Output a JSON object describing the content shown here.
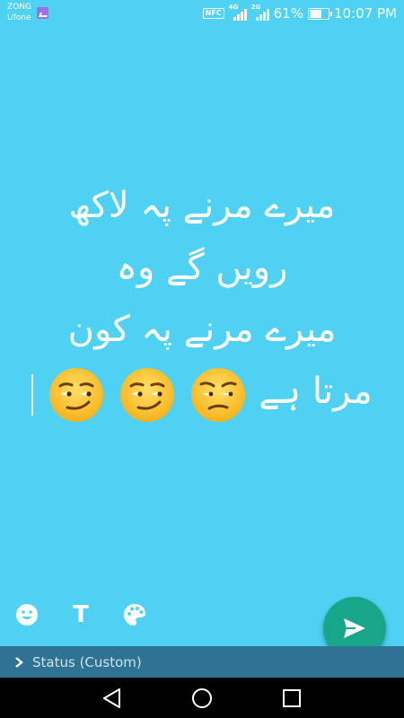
{
  "status_bar": {
    "carrier_1": "ZONG",
    "carrier_2": "Ufone",
    "nfc_label": "NFC",
    "network_1": "4G",
    "network_2": "2G",
    "battery_percent": "61%",
    "battery_level": 0.61,
    "time": "10:07 PM"
  },
  "editor": {
    "lines": [
      "میرے مرنے پہ لاکھ",
      "رویں گے وہ",
      "میرے مرنے پہ کون",
      "مرتا ہے"
    ],
    "emojis": [
      "smirking-face",
      "smirking-face",
      "unamused-face"
    ]
  },
  "toolbar": {
    "emoji_icon": "smiley-icon",
    "text_tool_label": "T",
    "palette_icon": "palette-icon",
    "send_icon": "send-icon"
  },
  "bottom_bar": {
    "chevron_icon": "chevron-right-icon",
    "status_label": "Status (Custom)"
  },
  "nav_bar": {
    "back_icon": "back-triangle-icon",
    "home_icon": "home-circle-icon",
    "recent_icon": "recent-square-icon"
  },
  "colors": {
    "background": "#4fd1f3",
    "fab": "#17a68a",
    "bottom_bar": "#2f7291",
    "text": "#ffffff"
  }
}
